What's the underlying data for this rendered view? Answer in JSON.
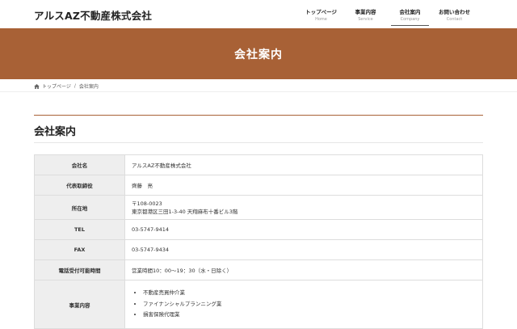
{
  "header": {
    "logo": "アルスAZ不動産株式会社",
    "nav": [
      {
        "ja": "トップページ",
        "en": "Home"
      },
      {
        "ja": "事業内容",
        "en": "Service"
      },
      {
        "ja": "会社案内",
        "en": "Company"
      },
      {
        "ja": "お問い合わせ",
        "en": "Contact"
      }
    ]
  },
  "hero": {
    "title": "会社案内"
  },
  "breadcrumb": {
    "home": "トップページ",
    "separator": "/",
    "current": "会社案内"
  },
  "section": {
    "title": "会社案内"
  },
  "table": {
    "company_label": "会社名",
    "company_value": "アルスAZ不動産株式会社",
    "rep_label": "代表取締役",
    "rep_value": "齊藤　亮",
    "addr_label": "所在地",
    "addr_zip": "〒108-0023",
    "addr_line": "東京都港区三田1-3-40 天翔麻布十番ビル3階",
    "tel_label": "TEL",
    "tel_value": "03-5747-9414",
    "fax_label": "FAX",
    "fax_value": "03-5747-9434",
    "hours_label": "電話受付可能時間",
    "hours_value": "営業時間10：00〜19：30（水・日除く）",
    "biz_label": "事業内容",
    "biz_items": [
      "不動産売買仲介業",
      "ファイナンシャルプランニング業",
      "損害保険代理業"
    ]
  },
  "colors": {
    "brand": "#a86136",
    "table_header_bg": "#eeeeee",
    "border": "#dddddd"
  }
}
